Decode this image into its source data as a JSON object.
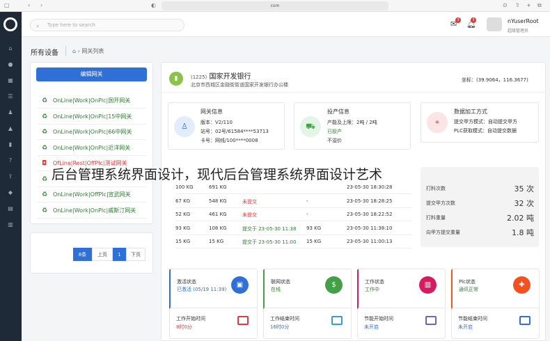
{
  "browser": {
    "url": "com"
  },
  "header": {
    "search_placeholder": "Type here to search",
    "mail_badge": "3",
    "bell_badge": "3",
    "username": "nYuserRoot",
    "role": "超级管理员"
  },
  "breadcrumb": {
    "title": "所有设备",
    "current": "网关列表"
  },
  "sidebar_left": {
    "edit_button": "编辑网关",
    "gateways": [
      {
        "label": "OnLine|Work|OnPlc|国开网关",
        "status": "online"
      },
      {
        "label": "OnLine|Work|OnPlc|15中网关",
        "status": "online"
      },
      {
        "label": "OnLine|Work|OnPlc|66中网关",
        "status": "online"
      },
      {
        "label": "OnLine|Work|OnPlc|近洋网关",
        "status": "online"
      },
      {
        "label": "OfLine|Rest|OffPlc|测试网关",
        "status": "offline"
      },
      {
        "label": "",
        "status": "online"
      },
      {
        "label": "OnLine|Work|OffPlc|宣武网关",
        "status": "partial"
      },
      {
        "label": "OnLine|Work|OnPlc|威斯汀网关",
        "status": "online"
      }
    ],
    "pagination": {
      "per_page": "8条",
      "prev": "上页",
      "page": "1",
      "next": "下页"
    }
  },
  "device": {
    "id": "(1225)",
    "name": "国家开发银行",
    "address": "北京市西城区金融街街道国家开发银行办公楼",
    "coord_label": "坐标：",
    "coord_value": "(39.9064，116.3677)"
  },
  "info_cards": [
    {
      "title": "网关信息",
      "lines": [
        "版本：V2/110",
        "站号：02号/61584****53713",
        "卡号：网线/100****0008"
      ]
    },
    {
      "title": "投产信息",
      "lines": [
        "产能及上限：2吨 / 2吨",
        "已投产",
        "不溢价"
      ]
    },
    {
      "title": "数据加工方式",
      "lines": [
        "提交甲方模式：自动提交甲方",
        "PLC获取模式：自动提交数据"
      ]
    }
  ],
  "table": {
    "rows": [
      {
        "a": "100 KG",
        "b": "691 KG",
        "status": "",
        "c": "",
        "time": "23-05-30 18:30:28"
      },
      {
        "a": "67 KG",
        "b": "548 KG",
        "status": "未提交",
        "c": "-",
        "time": "23-05-30 18:28:25"
      },
      {
        "a": "52 KG",
        "b": "461 KG",
        "status": "未提交",
        "c": "-",
        "time": "23-05-30 18:22:52"
      },
      {
        "a": "93 KG",
        "b": "108 KG",
        "status": "提交于 23-05-30 11:38",
        "c": "93 KG",
        "time": "23-05-30 11:38:10"
      },
      {
        "a": "15 KG",
        "b": "15 KG",
        "status": "提交于 23-05-30 11:00",
        "c": "15 KG",
        "time": "23-05-30 11:00:13"
      }
    ]
  },
  "stats": [
    {
      "label": "打料次数",
      "value": "35 次"
    },
    {
      "label": "提交甲方次数",
      "value": "32 次"
    },
    {
      "label": "打料重量",
      "value": "2.02 吨"
    },
    {
      "label": "向甲方提交重量",
      "value": "1.8 吨"
    }
  ],
  "status_cards": [
    {
      "title": "激活状态",
      "value": "已激活 (05/19 11:39)",
      "color": "#2e6fd8"
    },
    {
      "title": "联网状态",
      "value": "在线",
      "color": "#43a047"
    },
    {
      "title": "工作状态",
      "value": "工作中",
      "color": "#d81b60"
    },
    {
      "title": "Plc状态",
      "value": "通讯正常",
      "color": "#f4511e"
    }
  ],
  "time_cards": [
    {
      "title": "工作开始时间",
      "value": "8时0分"
    },
    {
      "title": "工作结束时间",
      "value": "16时0分"
    },
    {
      "title": "节能开始时间",
      "value": "未开启"
    },
    {
      "title": "节能结束时间",
      "value": "未开启"
    }
  ],
  "overlay_text": "后台管理系统界面设计，现代后台管理系统界面设计艺术"
}
